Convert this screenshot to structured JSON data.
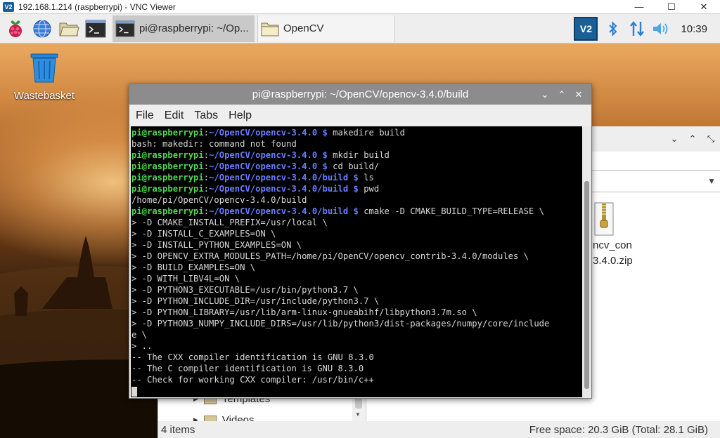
{
  "vnc": {
    "title": "192.168.1.214 (raspberrypi) - VNC Viewer",
    "logo": "V2",
    "controls": {
      "minimize": "—",
      "maximize": "☐",
      "close": "✕"
    }
  },
  "taskbar": {
    "tasks": [
      {
        "label": "pi@raspberrypi: ~/Op...",
        "icon": "terminal-icon"
      },
      {
        "label": "OpenCV",
        "icon": "folder-icon"
      }
    ],
    "tray_vnc": "V2",
    "clock": "10:39"
  },
  "desktop": {
    "wastebasket_label": "Wastebasket"
  },
  "file_manager": {
    "title_buttons": {
      "menu": "⌄",
      "maximize": "⌃",
      "close": "⤡"
    },
    "zip_name_line1": "ncv_con",
    "zip_name_line2": "3.4.0.zip",
    "tree": [
      {
        "label": "Templates"
      },
      {
        "label": "Videos"
      }
    ],
    "status_left": "4 items",
    "status_right": "Free space: 20.3 GiB (Total: 28.1 GiB)"
  },
  "terminal": {
    "title": "pi@raspberrypi: ~/OpenCV/opencv-3.4.0/build",
    "buttons": {
      "menu": "⌄",
      "maximize": "⌃",
      "close": "✕"
    },
    "menu": [
      "File",
      "Edit",
      "Tabs",
      "Help"
    ],
    "user": "pi@raspberrypi",
    "lines": [
      {
        "type": "prompt",
        "path": "~/OpenCV/opencv-3.4.0",
        "cmd": " makedire build"
      },
      {
        "type": "out",
        "text": "bash: makedir: command not found"
      },
      {
        "type": "prompt",
        "path": "~/OpenCV/opencv-3.4.0",
        "cmd": " mkdir build"
      },
      {
        "type": "prompt",
        "path": "~/OpenCV/opencv-3.4.0",
        "cmd": " cd build/"
      },
      {
        "type": "prompt",
        "path": "~/OpenCV/opencv-3.4.0/build",
        "cmd": " ls"
      },
      {
        "type": "prompt",
        "path": "~/OpenCV/opencv-3.4.0/build",
        "cmd": " pwd"
      },
      {
        "type": "out",
        "text": "/home/pi/OpenCV/opencv-3.4.0/build"
      },
      {
        "type": "prompt",
        "path": "~/OpenCV/opencv-3.4.0/build",
        "cmd": " cmake -D CMAKE_BUILD_TYPE=RELEASE \\"
      },
      {
        "type": "out",
        "text": "> -D CMAKE_INSTALL_PREFIX=/usr/local \\"
      },
      {
        "type": "out",
        "text": "> -D INSTALL_C_EXAMPLES=ON \\"
      },
      {
        "type": "out",
        "text": "> -D INSTALL_PYTHON_EXAMPLES=ON \\"
      },
      {
        "type": "out",
        "text": "> -D OPENCV_EXTRA_MODULES_PATH=/home/pi/OpenCV/opencv_contrib-3.4.0/modules \\"
      },
      {
        "type": "out",
        "text": "> -D BUILD_EXAMPLES=ON \\"
      },
      {
        "type": "out",
        "text": "> -D WITH_LIBV4L=ON \\"
      },
      {
        "type": "out",
        "text": "> -D PYTHON3_EXECUTABLE=/usr/bin/python3.7 \\"
      },
      {
        "type": "out",
        "text": "> -D PYTHON_INCLUDE_DIR=/usr/include/python3.7 \\"
      },
      {
        "type": "out",
        "text": "> -D PYTHON_LIBRARY=/usr/lib/arm-linux-gnueabihf/libpython3.7m.so \\"
      },
      {
        "type": "out",
        "text": "> -D PYTHON3_NUMPY_INCLUDE_DIRS=/usr/lib/python3/dist-packages/numpy/core/include"
      },
      {
        "type": "out",
        "text": "e \\"
      },
      {
        "type": "out",
        "text": "> .."
      },
      {
        "type": "out",
        "text": "-- The CXX compiler identification is GNU 8.3.0"
      },
      {
        "type": "out",
        "text": "-- The C compiler identification is GNU 8.3.0"
      },
      {
        "type": "out",
        "text": "-- Check for working CXX compiler: /usr/bin/c++"
      }
    ]
  },
  "colors": {
    "prompt_user": "#4fd94f",
    "prompt_path": "#6b7dff",
    "vnc_blue": "#1a5f96",
    "bluetooth": "#2a7fd4"
  }
}
